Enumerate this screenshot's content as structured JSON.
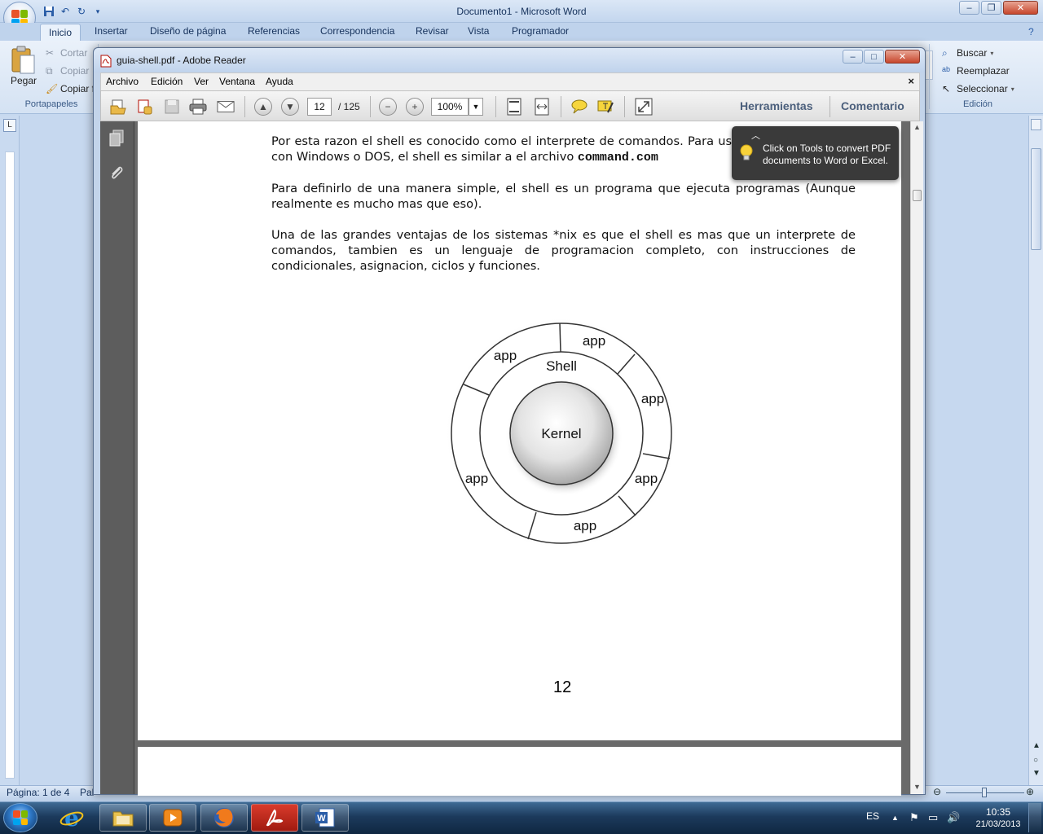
{
  "word": {
    "title": "Documento1 - Microsoft Word",
    "tabs": [
      "Inicio",
      "Insertar",
      "Diseño de página",
      "Referencias",
      "Correspondencia",
      "Revisar",
      "Vista",
      "Programador"
    ],
    "clipboard": {
      "paste": "Pegar",
      "cut": "Cortar",
      "copy": "Copiar",
      "format_painter": "Copiar f",
      "group": "Portapapeles"
    },
    "editing": {
      "find": "Buscar",
      "replace": "Reemplazar",
      "select": "Seleccionar",
      "group": "Edición"
    },
    "status": {
      "pages": "Página: 1 de 4",
      "words": "Pal"
    },
    "ruler_corner": "L"
  },
  "reader": {
    "title": "guia-shell.pdf - Adobe Reader",
    "menu": [
      "Archivo",
      "Edición",
      "Ver",
      "Ventana",
      "Ayuda"
    ],
    "current_page": "12",
    "total_pages": "/ 125",
    "zoom": "100%",
    "tools": "Herramientas",
    "comment": "Comentario",
    "tooltip": "Click on Tools to convert PDF documents to Word or Excel."
  },
  "pdf": {
    "para1_a": "Por esta razon el shell es conocido como el interprete de comandos. Para usuarios familiarizados con Windows o DOS, el shell es similar a el archivo",
    "para1_code": "command.com",
    "para2": "Para definirlo de una manera simple, el shell es un programa que ejecuta programas (Aunque realmente es mucho mas que eso).",
    "para3": "Una de las grandes ventajas de los sistemas *nix es que el shell es mas que un interprete de comandos, tambien es un lenguaje de programacion completo, con instrucciones de condicionales, asignacion, ciclos y funciones.",
    "diagram": {
      "kernel": "Kernel",
      "shell": "Shell",
      "app": "app"
    },
    "page_number": "12"
  },
  "taskbar": {
    "language": "ES",
    "time": "10:35",
    "date": "21/03/2013"
  }
}
